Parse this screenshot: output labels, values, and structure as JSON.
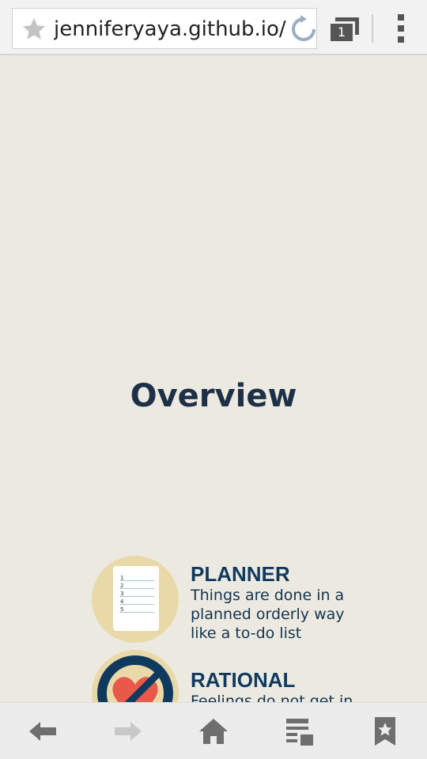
{
  "browser": {
    "url": "jenniferyaya.github.io/",
    "tab_count": "1",
    "icons": {
      "bookmark_star": "star-icon",
      "reload": "reload-icon",
      "tabs": "tabs-icon",
      "menu": "overflow-menu-icon"
    }
  },
  "page": {
    "heading": "Overview",
    "traits": [
      {
        "title": "PLANNER",
        "lines": [
          "Things are done in a",
          "planned orderly way",
          "like a to-do list"
        ],
        "list_numbers": [
          "1",
          "2",
          "3",
          "4",
          "5"
        ]
      },
      {
        "title": "RATIONAL",
        "lines": [
          "Feelings do not get in"
        ]
      }
    ]
  },
  "bottom_nav": {
    "items": [
      "back-icon",
      "forward-icon",
      "home-icon",
      "reading-list-icon",
      "bookmarks-icon"
    ]
  },
  "colors": {
    "page_bg": "#ece9e0",
    "heading": "#1e3048",
    "accent_navy": "#0f3a5e",
    "circle_bg": "#ead9a8",
    "heart": "#e8594a"
  }
}
